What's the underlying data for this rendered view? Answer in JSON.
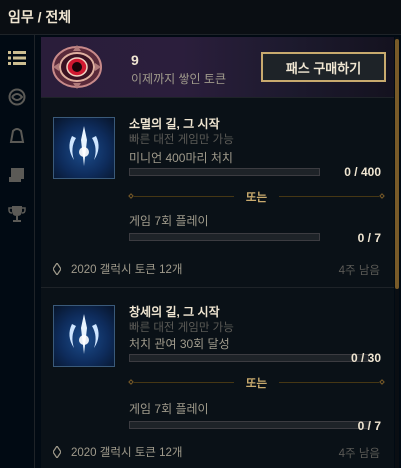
{
  "header": {
    "title": "임무 / 전체"
  },
  "rail": {
    "items": [
      {
        "name": "list-icon",
        "active": true
      },
      {
        "name": "swirl-icon",
        "active": false
      },
      {
        "name": "bell-icon",
        "active": false
      },
      {
        "name": "scroll-icon",
        "active": false
      },
      {
        "name": "trophy-icon",
        "active": false
      }
    ]
  },
  "banner": {
    "token_count": "9",
    "token_label": "이제까지 쌓인 토큰",
    "buy_label": "패스 구매하기"
  },
  "missions": [
    {
      "title": "소멸의 길, 그 시작",
      "subtitle": "빠른 대전 게임만 가능",
      "objective1": {
        "label": "미니언 400마리 처치",
        "value": "0 / 400",
        "progress": 0
      },
      "or_label": "또는",
      "objective2": {
        "label": "게임 7회 플레이",
        "value": "0 / 7",
        "progress": 0
      },
      "reward": "2020 갤럭시 토큰 12개",
      "remaining": "4주 남음"
    },
    {
      "title": "창세의 길, 그 시작",
      "subtitle": "빠른 대전 게임만 가능",
      "objective1": {
        "label": "처치 관여 30회 달성",
        "value": "0 / 30",
        "progress": 0
      },
      "or_label": "또는",
      "objective2": {
        "label": "게임 7회 플레이",
        "value": "0 / 7",
        "progress": 0
      },
      "reward": "2020 갤럭시 토큰 12개",
      "remaining": "4주 남음"
    }
  ],
  "colors": {
    "gold": "#c8aa6e",
    "teal": "#0ac8b9",
    "background": "#010a13"
  }
}
